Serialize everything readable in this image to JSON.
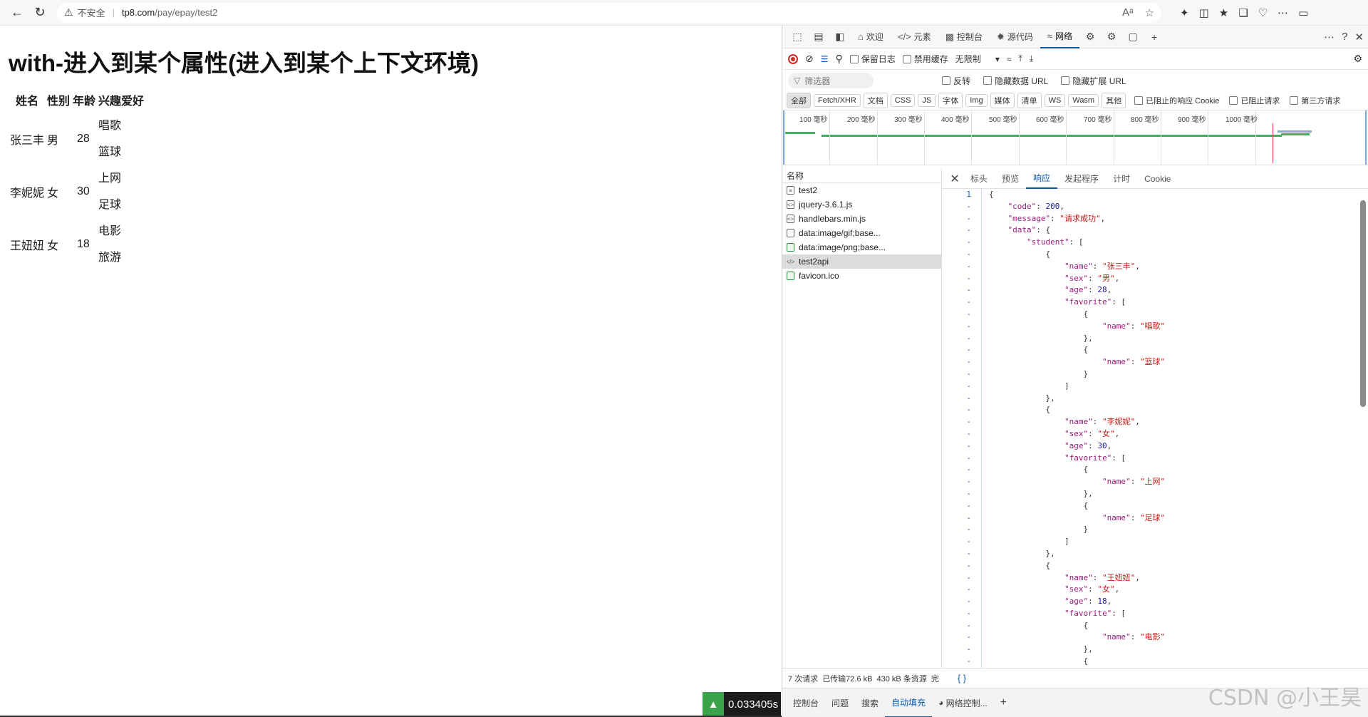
{
  "browser": {
    "insecure_label": "不安全",
    "host": "tp8.com",
    "path": "/pay/epay/test2"
  },
  "page": {
    "title": "with-进入到某个属性(进入到某个上下文环境)",
    "headers": [
      "姓名",
      "性别",
      "年龄",
      "兴趣爱好"
    ],
    "rows": [
      {
        "name": "张三丰",
        "sex": "男",
        "age": "28",
        "favorites": [
          "唱歌",
          "篮球"
        ]
      },
      {
        "name": "李妮妮",
        "sex": "女",
        "age": "30",
        "favorites": [
          "上网",
          "足球"
        ]
      },
      {
        "name": "王妞妞",
        "sex": "女",
        "age": "18",
        "favorites": [
          "电影",
          "旅游"
        ]
      }
    ],
    "timer": "0.033405s"
  },
  "devtools": {
    "tabs": [
      "欢迎",
      "元素",
      "控制台",
      "源代码",
      "网络"
    ],
    "active_tab": "网络",
    "toolbar": {
      "preserve_log": "保留日志",
      "disable_cache": "禁用缓存",
      "throttle": "无限制"
    },
    "filter": {
      "placeholder": "筛选器",
      "invert": "反转",
      "hide_data_url": "隐藏数据 URL",
      "hide_ext_url": "隐藏扩展 URL"
    },
    "type_filters": [
      "全部",
      "Fetch/XHR",
      "文档",
      "CSS",
      "JS",
      "字体",
      "Img",
      "媒体",
      "清单",
      "WS",
      "Wasm",
      "其他"
    ],
    "type_checks": [
      "已阻止的响应 Cookie",
      "已阻止请求",
      "第三方请求"
    ],
    "timeline_labels": [
      "100 毫秒",
      "200 毫秒",
      "300 毫秒",
      "400 毫秒",
      "500 毫秒",
      "600 毫秒",
      "700 毫秒",
      "800 毫秒",
      "900 毫秒",
      "1000 毫秒"
    ],
    "name_header": "名称",
    "requests": [
      {
        "name": "test2",
        "icon": "doc"
      },
      {
        "name": "jquery-3.6.1.js",
        "icon": "script"
      },
      {
        "name": "handlebars.min.js",
        "icon": "script"
      },
      {
        "name": "data:image/gif;base...",
        "icon": "file"
      },
      {
        "name": "data:image/png;base...",
        "icon": "img"
      },
      {
        "name": "test2api",
        "icon": "xhr",
        "selected": true
      },
      {
        "name": "favicon.ico",
        "icon": "img"
      }
    ],
    "detail_tabs": [
      "标头",
      "预览",
      "响应",
      "发起程序",
      "计时",
      "Cookie"
    ],
    "active_detail_tab": "响应",
    "status": {
      "requests": "7 次请求",
      "transferred": "已传输72.6 kB",
      "resources": "430 kB 条资源",
      "extra": "完",
      "braces": "{ }"
    },
    "drawer_tabs": [
      "控制台",
      "问题",
      "搜索",
      "自动填充",
      "网络控制..."
    ],
    "active_drawer_tab": "自动填充"
  },
  "watermark": "CSDN @小王昊"
}
